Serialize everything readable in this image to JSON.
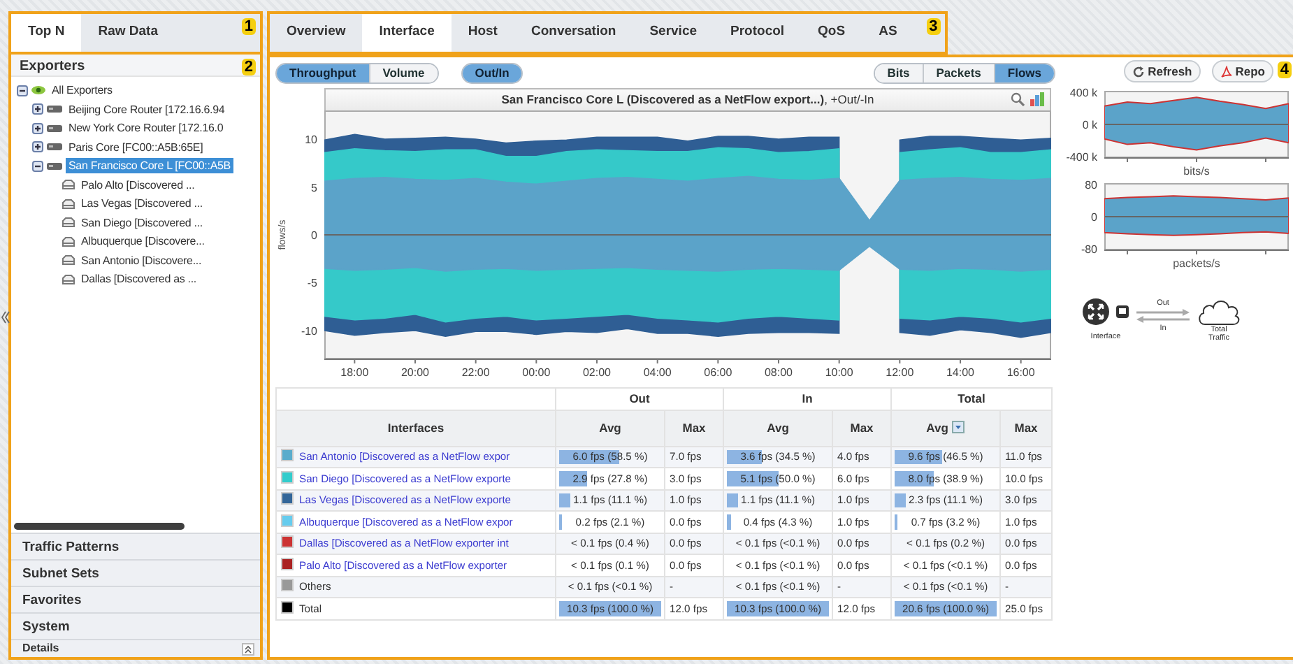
{
  "left_tabs": [
    {
      "label": "Top N",
      "selected": true
    },
    {
      "label": "Raw Data",
      "selected": false
    }
  ],
  "callouts": [
    "1",
    "2",
    "3",
    "4"
  ],
  "exporters": {
    "title": "Exporters",
    "tree": [
      {
        "label": "All Exporters",
        "kind": "group",
        "expanded": true,
        "selected": false,
        "children": [
          {
            "label": "Beijing Core Router [172.16.6.94",
            "kind": "router",
            "expanded": false,
            "selected": false
          },
          {
            "label": "New York Core Router [172.16.0",
            "kind": "router",
            "expanded": false,
            "selected": false
          },
          {
            "label": "Paris Core [FC00::A5B:65E]",
            "kind": "router",
            "expanded": false,
            "selected": false
          },
          {
            "label": "San Francisco Core L [FC00::A5B",
            "kind": "router",
            "expanded": true,
            "selected": true,
            "children": [
              {
                "label": "Palo Alto [Discovered ...",
                "kind": "interface",
                "selected": false
              },
              {
                "label": "Las Vegas [Discovered ...",
                "kind": "interface",
                "selected": false
              },
              {
                "label": "San Diego [Discovered ...",
                "kind": "interface",
                "selected": false
              },
              {
                "label": "Albuquerque [Discovere...",
                "kind": "interface",
                "selected": false
              },
              {
                "label": "San Antonio [Discovere...",
                "kind": "interface",
                "selected": false
              },
              {
                "label": "Dallas [Discovered as ...",
                "kind": "interface",
                "selected": false
              }
            ]
          }
        ]
      }
    ]
  },
  "accordion": [
    "Traffic Patterns",
    "Subnet Sets",
    "Favorites",
    "System"
  ],
  "details": "Details",
  "view_tabs": [
    {
      "label": "Overview",
      "selected": false
    },
    {
      "label": "Interface",
      "selected": true
    },
    {
      "label": "Host",
      "selected": false
    },
    {
      "label": "Conversation",
      "selected": false
    },
    {
      "label": "Service",
      "selected": false
    },
    {
      "label": "Protocol",
      "selected": false
    },
    {
      "label": "QoS",
      "selected": false
    },
    {
      "label": "AS",
      "selected": false
    }
  ],
  "metric_toggle": [
    {
      "label": "Throughput",
      "selected": true
    },
    {
      "label": "Volume",
      "selected": false
    }
  ],
  "direction_toggle": {
    "label": "Out/In",
    "selected": true
  },
  "unit_toggle": [
    {
      "label": "Bits",
      "selected": false
    },
    {
      "label": "Packets",
      "selected": false
    },
    {
      "label": "Flows",
      "selected": true
    }
  ],
  "actions": [
    "Refresh",
    "Repo"
  ],
  "main_chart": {
    "title": "**San Francisco Core L (Discovered as a NetFlow export...)**, +Out/-In",
    "chart_data": {
      "type": "area",
      "stacked": false,
      "ylabel": "flows/s",
      "ylim": [
        -13,
        13
      ],
      "yticks": [
        -10,
        -5,
        0,
        5,
        10
      ],
      "categories": [
        null,
        "18:00",
        null,
        "20:00",
        null,
        "22:00",
        null,
        "00:00",
        null,
        "02:00",
        null,
        "04:00",
        null,
        "06:00",
        null,
        "08:00",
        null,
        "10:00",
        null,
        "12:00",
        null,
        "14:00",
        null,
        "16:00",
        null
      ],
      "series": [
        {
          "color": "#2f5e94",
          "values": [
            9.9,
            10.5,
            10.0,
            10.1,
            10.2,
            10.0,
            9.6,
            9.8,
            9.9,
            10.2,
            10.2,
            10.2,
            9.8,
            10.3,
            10.3,
            10.0,
            10.2,
            10.2,
            null,
            9.9,
            10.3,
            10.3,
            10.1,
            9.9,
            10.1
          ]
        },
        {
          "color": "#35c9c9",
          "values": [
            8.6,
            9.0,
            8.8,
            8.7,
            8.9,
            8.9,
            8.2,
            8.2,
            8.7,
            8.9,
            8.8,
            8.7,
            8.7,
            9.1,
            9.0,
            8.6,
            8.7,
            9.0,
            null,
            8.6,
            8.9,
            9.1,
            8.6,
            8.6,
            8.9
          ]
        },
        {
          "color": "#5ba3c9",
          "values": [
            5.6,
            5.9,
            6.0,
            5.8,
            5.7,
            5.9,
            5.5,
            5.3,
            5.6,
            5.9,
            6.0,
            5.8,
            5.6,
            5.9,
            6.1,
            5.8,
            5.7,
            5.9,
            1.5,
            5.7,
            5.9,
            6.0,
            5.8,
            5.7,
            5.9
          ]
        },
        {
          "color": "#2f5e94",
          "values": [
            -10.0,
            -10.5,
            -10.2,
            -10.0,
            -10.6,
            -10.1,
            -10.1,
            -10.4,
            -10.1,
            -10.2,
            -9.8,
            -10.3,
            -10.3,
            -10.6,
            -10.3,
            -10.2,
            -10.2,
            -10.3,
            null,
            -10.2,
            -10.5,
            -9.9,
            -10.2,
            -10.7,
            -10.2
          ]
        },
        {
          "color": "#35c9c9",
          "values": [
            -8.5,
            -8.9,
            -8.7,
            -8.3,
            -9.1,
            -8.7,
            -8.5,
            -8.9,
            -8.7,
            -8.5,
            -8.3,
            -8.7,
            -8.9,
            -9.1,
            -8.7,
            -8.5,
            -8.7,
            -8.9,
            null,
            -8.7,
            -8.9,
            -8.5,
            -8.7,
            -9.1,
            -8.7
          ]
        },
        {
          "color": "#5ba3c9",
          "values": [
            -3.5,
            -3.7,
            -3.6,
            -3.4,
            -3.8,
            -3.6,
            -3.5,
            -3.7,
            -3.6,
            -3.5,
            -3.4,
            -3.6,
            -3.7,
            -3.8,
            -3.6,
            -3.5,
            -3.6,
            -3.7,
            -1.2,
            -3.6,
            -3.7,
            -3.5,
            -3.6,
            -3.8,
            -3.6
          ]
        }
      ]
    }
  },
  "bits_chart": {
    "chart_data": {
      "type": "area",
      "stacked": false,
      "xlabel": "bits/s",
      "ylim": [
        -420000,
        420000
      ],
      "yticks": [
        {
          "value": -400000,
          "label": "-400 k"
        },
        {
          "value": 0,
          "label": "0 k"
        },
        {
          "value": 400000,
          "label": "400 k"
        }
      ],
      "categories": [
        null,
        null,
        null,
        null,
        null,
        null,
        null,
        null,
        null
      ],
      "series": [
        {
          "color": "#5ba3c9",
          "values": [
            230000,
            280000,
            260000,
            300000,
            340000,
            290000,
            250000,
            200000,
            260000
          ]
        },
        {
          "color": "#5ba3c9",
          "values": [
            -180000,
            -250000,
            -230000,
            -280000,
            -320000,
            -270000,
            -230000,
            -170000,
            -230000
          ]
        }
      ]
    }
  },
  "packets_chart": {
    "chart_data": {
      "type": "area",
      "stacked": false,
      "xlabel": "packets/s",
      "ylim": [
        -84,
        84
      ],
      "yticks": [
        {
          "value": -80,
          "label": "-80"
        },
        {
          "value": 0,
          "label": "0"
        },
        {
          "value": 80,
          "label": "80"
        }
      ],
      "categories": [
        null,
        null,
        null,
        null,
        null,
        null,
        null,
        null,
        null
      ],
      "series": [
        {
          "color": "#5ba3c9",
          "values": [
            45,
            48,
            50,
            52,
            50,
            48,
            45,
            42,
            47
          ]
        },
        {
          "color": "#5ba3c9",
          "values": [
            -40,
            -43,
            -45,
            -47,
            -45,
            -43,
            -40,
            -38,
            -42
          ]
        }
      ]
    }
  },
  "diagram": {
    "node_label": "Interface",
    "out_label": "Out",
    "in_label": "In",
    "target_label": "Total Traffic"
  },
  "table": {
    "groups": [
      "Out",
      "In",
      "Total"
    ],
    "columns": [
      {
        "label": "Interfaces",
        "sorted": false
      },
      {
        "label": "Avg",
        "sorted": false
      },
      {
        "label": "Max",
        "sorted": false
      },
      {
        "label": "Avg",
        "sorted": false
      },
      {
        "label": "Max",
        "sorted": false
      },
      {
        "label": "Avg",
        "sorted": true
      },
      {
        "label": "Max",
        "sorted": false
      }
    ],
    "rows": [
      {
        "kind": "link",
        "color": "#5aaccc",
        "cells": [
          {
            "text": "San Antonio [Discovered as a NetFlow expor"
          },
          {
            "text": "6.0 fps (58.5 %)",
            "level": 0.585
          },
          {
            "text": "7.0 fps"
          },
          {
            "text": "3.6 fps (34.5 %)",
            "level": 0.345
          },
          {
            "text": "4.0 fps"
          },
          {
            "text": "9.6 fps (46.5 %)",
            "level": 0.465
          },
          {
            "text": "11.0 fps"
          }
        ]
      },
      {
        "kind": "link",
        "color": "#33cccc",
        "cells": [
          {
            "text": "San Diego [Discovered as a NetFlow exporte"
          },
          {
            "text": "2.9 fps (27.8 %)",
            "level": 0.278
          },
          {
            "text": "3.0 fps"
          },
          {
            "text": "5.1 fps (50.0 %)",
            "level": 0.5
          },
          {
            "text": "6.0 fps"
          },
          {
            "text": "8.0 fps (38.9 %)",
            "level": 0.389
          },
          {
            "text": "10.0 fps"
          }
        ]
      },
      {
        "kind": "link",
        "color": "#336699",
        "cells": [
          {
            "text": "Las Vegas [Discovered as a NetFlow exporte"
          },
          {
            "text": "1.1 fps (11.1 %)",
            "level": 0.111
          },
          {
            "text": "1.0 fps"
          },
          {
            "text": "1.1 fps (11.1 %)",
            "level": 0.111
          },
          {
            "text": "1.0 fps"
          },
          {
            "text": "2.3 fps (11.1 %)",
            "level": 0.111
          },
          {
            "text": "3.0 fps"
          }
        ]
      },
      {
        "kind": "link",
        "color": "#66ccee",
        "cells": [
          {
            "text": "Albuquerque [Discovered as a NetFlow expor"
          },
          {
            "text": "0.2 fps (2.1 %)",
            "level": 0.021
          },
          {
            "text": "0.0 fps"
          },
          {
            "text": "0.4 fps (4.3 %)",
            "level": 0.043
          },
          {
            "text": "1.0 fps"
          },
          {
            "text": "0.7 fps (3.2 %)",
            "level": 0.032
          },
          {
            "text": "1.0 fps"
          }
        ]
      },
      {
        "kind": "link",
        "color": "#cc3333",
        "cells": [
          {
            "text": "Dallas [Discovered as a NetFlow exporter int"
          },
          {
            "text": "< 0.1 fps (0.4 %)"
          },
          {
            "text": "0.0 fps"
          },
          {
            "text": "< 0.1 fps (<0.1 %)"
          },
          {
            "text": "0.0 fps"
          },
          {
            "text": "< 0.1 fps (0.2 %)"
          },
          {
            "text": "0.0 fps"
          }
        ]
      },
      {
        "kind": "link",
        "color": "#aa2222",
        "cells": [
          {
            "text": "Palo Alto [Discovered as a NetFlow exporter"
          },
          {
            "text": "< 0.1 fps (0.1 %)"
          },
          {
            "text": "0.0 fps"
          },
          {
            "text": "< 0.1 fps (<0.1 %)"
          },
          {
            "text": "0.0 fps"
          },
          {
            "text": "< 0.1 fps (<0.1 %)"
          },
          {
            "text": "0.0 fps"
          }
        ]
      },
      {
        "kind": "plain",
        "color": "#999999",
        "cells": [
          {
            "text": "Others"
          },
          {
            "text": "< 0.1 fps (<0.1 %)"
          },
          {
            "text": "-"
          },
          {
            "text": "< 0.1 fps (<0.1 %)"
          },
          {
            "text": "-"
          },
          {
            "text": "< 0.1 fps (<0.1 %)"
          },
          {
            "text": "-"
          }
        ]
      },
      {
        "kind": "plain",
        "color": "#000000",
        "cells": [
          {
            "text": "Total"
          },
          {
            "text": "10.3 fps (100.0 %)",
            "level": 1
          },
          {
            "text": "12.0 fps"
          },
          {
            "text": "10.3 fps (100.0 %)",
            "level": 1
          },
          {
            "text": "12.0 fps"
          },
          {
            "text": "20.6 fps (100.0 %)",
            "level": 1
          },
          {
            "text": "25.0 fps"
          }
        ]
      }
    ]
  }
}
